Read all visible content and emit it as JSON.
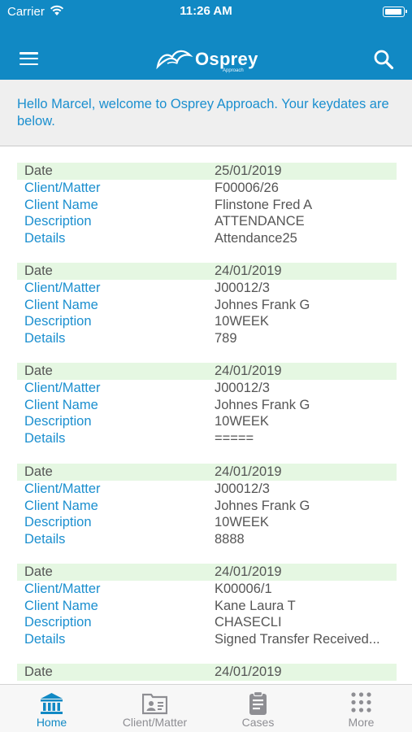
{
  "status_bar": {
    "carrier": "Carrier",
    "time": "11:26 AM"
  },
  "header": {
    "logo_text": "Osprey",
    "logo_sub": "Approach",
    "menu_icon": "hamburger-menu-icon",
    "search_icon": "search-icon",
    "background": "#1189c4"
  },
  "welcome_message": "Hello  Marcel, welcome to Osprey Approach. Your keydates are below.",
  "labels": {
    "date": "Date",
    "client_matter": "Client/Matter",
    "client_name": "Client Name",
    "description": "Description",
    "details": "Details"
  },
  "keydates": [
    {
      "date": "25/01/2019",
      "client_matter": "F00006/26",
      "client_name": "Flinstone Fred A",
      "description": "ATTENDANCE",
      "details": "Attendance25"
    },
    {
      "date": "24/01/2019",
      "client_matter": "J00012/3",
      "client_name": "Johnes Frank G",
      "description": "10WEEK",
      "details": "789"
    },
    {
      "date": "24/01/2019",
      "client_matter": "J00012/3",
      "client_name": "Johnes Frank G",
      "description": "10WEEK",
      "details": "====="
    },
    {
      "date": "24/01/2019",
      "client_matter": "J00012/3",
      "client_name": "Johnes Frank G",
      "description": "10WEEK",
      "details": "8888"
    },
    {
      "date": "24/01/2019",
      "client_matter": "K00006/1",
      "client_name": "Kane Laura T",
      "description": "CHASECLI",
      "details": "Signed Transfer Received..."
    },
    {
      "date": "24/01/2019"
    }
  ],
  "tabs": [
    {
      "label": "Home",
      "icon": "bank-icon",
      "active": true
    },
    {
      "label": "Client/Matter",
      "icon": "contact-card-icon",
      "active": false
    },
    {
      "label": "Cases",
      "icon": "clipboard-icon",
      "active": false
    },
    {
      "label": "More",
      "icon": "grid-dots-icon",
      "active": false
    }
  ],
  "colors": {
    "accent": "#1189c4",
    "label_blue": "#1b8fcf",
    "date_row_bg": "#e5f7e2",
    "inactive_tab": "#8e8e93"
  }
}
